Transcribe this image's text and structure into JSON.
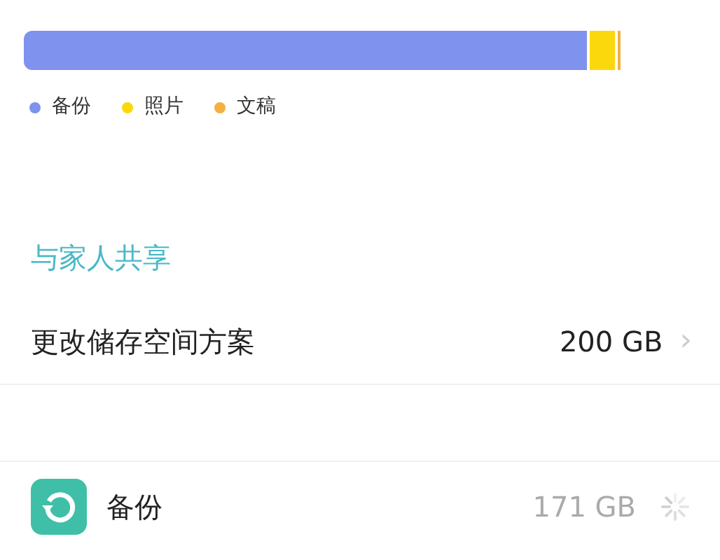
{
  "storage_bar": {
    "segments": [
      {
        "name": "备份",
        "color": "#7f92ee"
      },
      {
        "name": "照片",
        "color": "#fbd80b"
      },
      {
        "name": "文稿",
        "color": "#f5b042"
      }
    ]
  },
  "family_link": "与家人共享",
  "plan": {
    "label": "更改储存空间方案",
    "value": "200 GB",
    "chevron": "›"
  },
  "items": [
    {
      "label": "备份",
      "size": "171 GB",
      "loading": true
    }
  ]
}
